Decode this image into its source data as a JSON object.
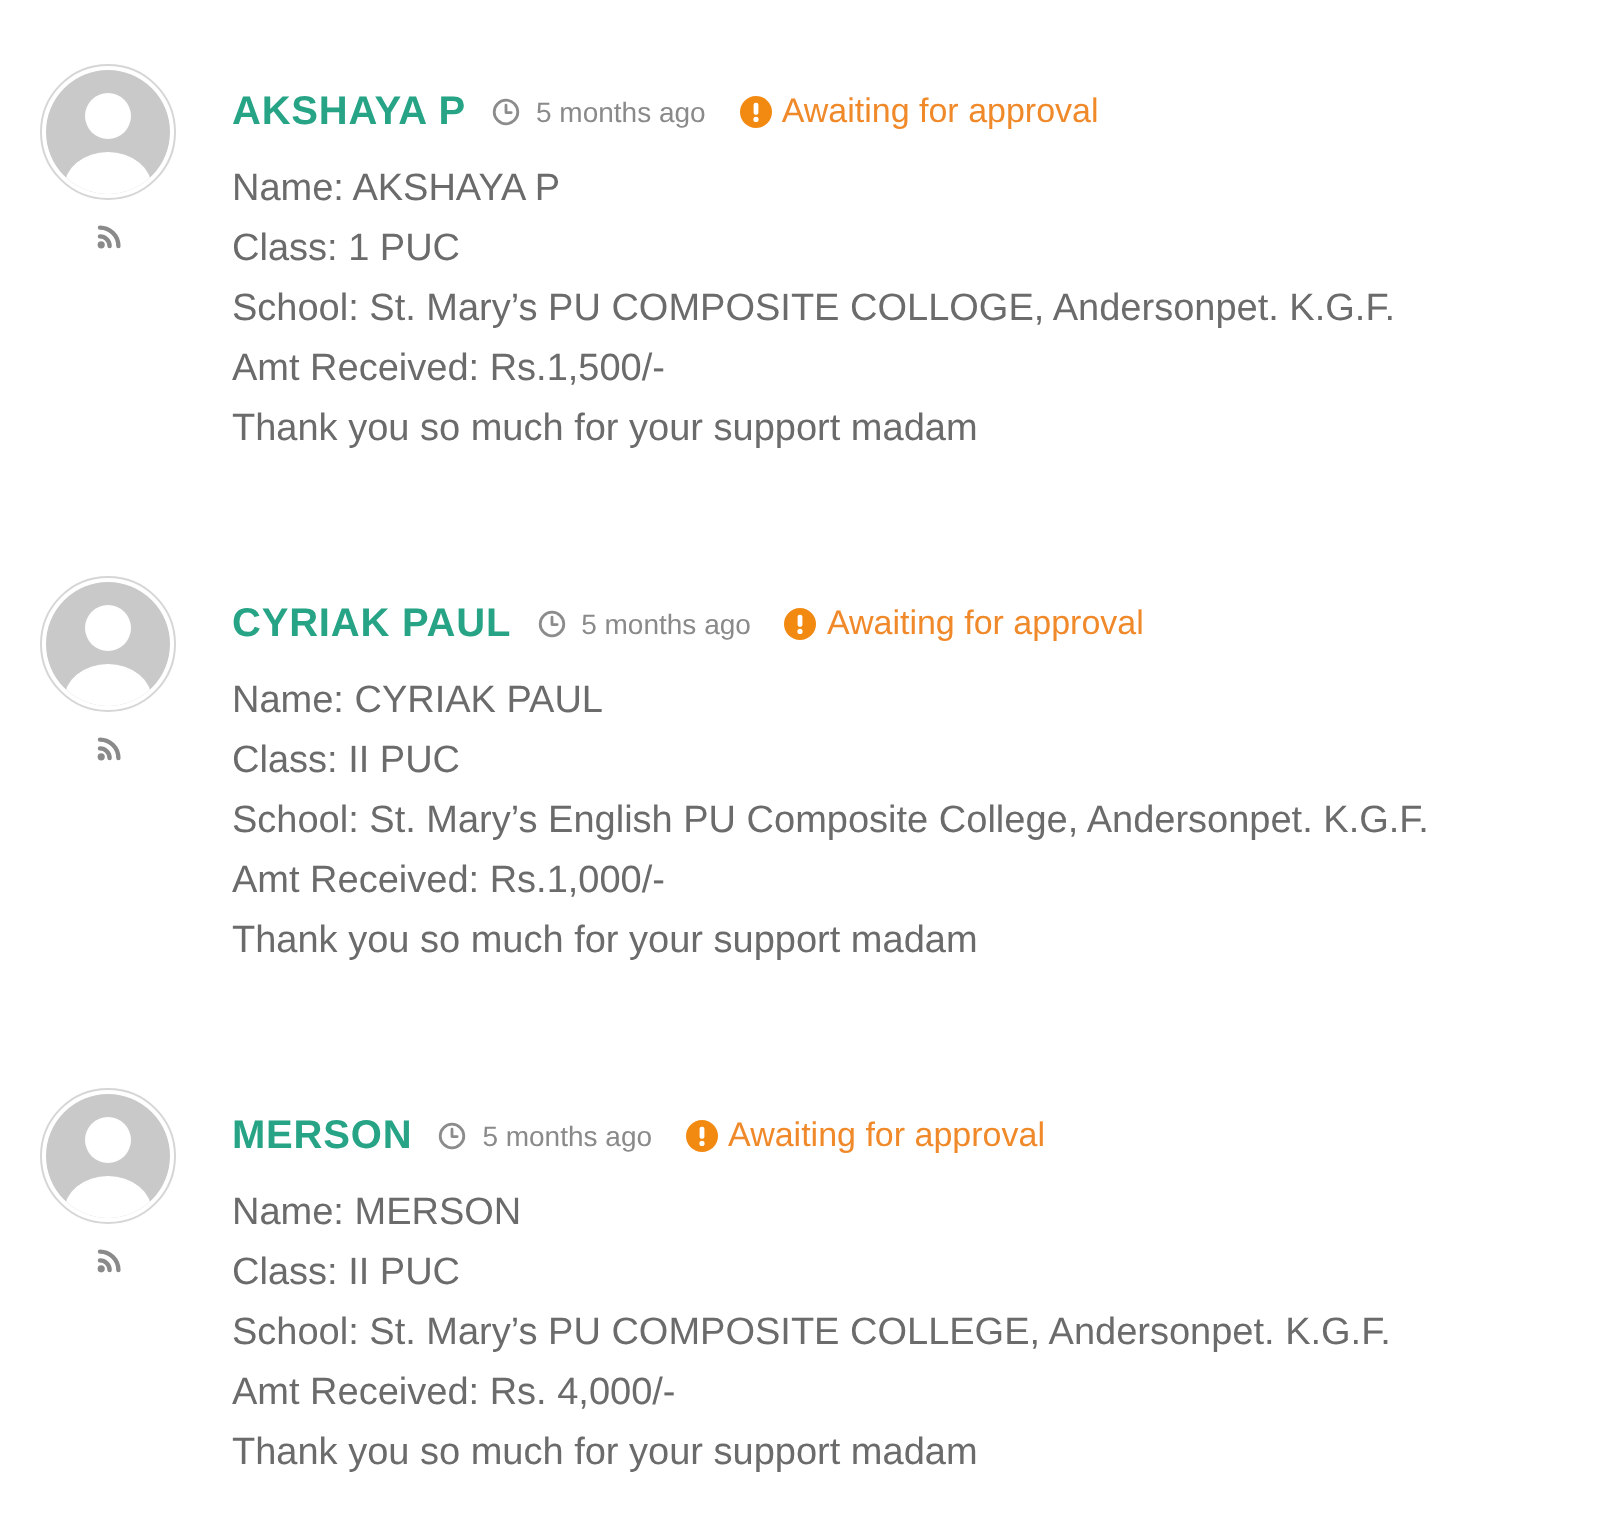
{
  "comments": [
    {
      "author": "AKSHAYA P",
      "time": "5 months ago",
      "status": "Awaiting for approval",
      "lines": [
        "Name: AKSHAYA P",
        "Class: 1 PUC",
        "School: St. Mary’s PU COMPOSITE COLLOGE, Andersonpet. K.G.F.",
        "Amt Received: Rs.1,500/-",
        "Thank you so much for your support madam"
      ]
    },
    {
      "author": "CYRIAK PAUL",
      "time": "5 months ago",
      "status": "Awaiting for approval",
      "lines": [
        "Name: CYRIAK PAUL",
        "Class: II PUC",
        "School: St. Mary’s English PU Composite College, Andersonpet. K.G.F.",
        "Amt Received: Rs.1,000/-",
        "Thank you so much for your support madam"
      ]
    },
    {
      "author": "MERSON",
      "time": "5 months ago",
      "status": "Awaiting for approval",
      "lines": [
        "Name: MERSON",
        "Class: II PUC",
        "School: St. Mary’s PU COMPOSITE COLLEGE, Andersonpet. K.G.F.",
        "Amt Received: Rs. 4,000/-",
        "Thank you so much for your support madam"
      ]
    }
  ]
}
